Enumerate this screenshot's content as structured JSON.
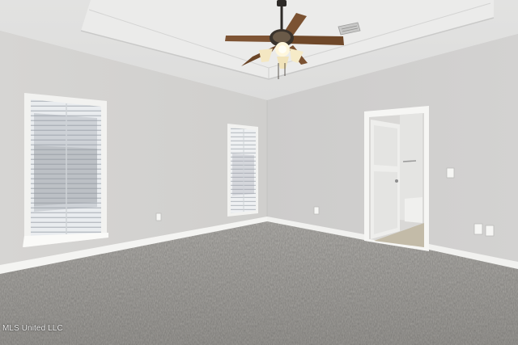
{
  "watermark": {
    "text": "MLS United LLC"
  },
  "colors": {
    "left_wall": "#d8d7d5",
    "right_wall": "#cfcecd",
    "ceiling": "#e4e4e3",
    "carpet": "#a9a7a3",
    "trim": "#f3f3f1",
    "fan_blade": "#7b5232",
    "fan_light": "#f4e7c2",
    "door": "#eeeeec"
  },
  "icons": {
    "ceiling_fan": "ceiling-fan-icon",
    "air_vent": "air-vent-icon",
    "wall_outlet": "wall-outlet-icon",
    "light_switch": "light-switch-icon"
  }
}
